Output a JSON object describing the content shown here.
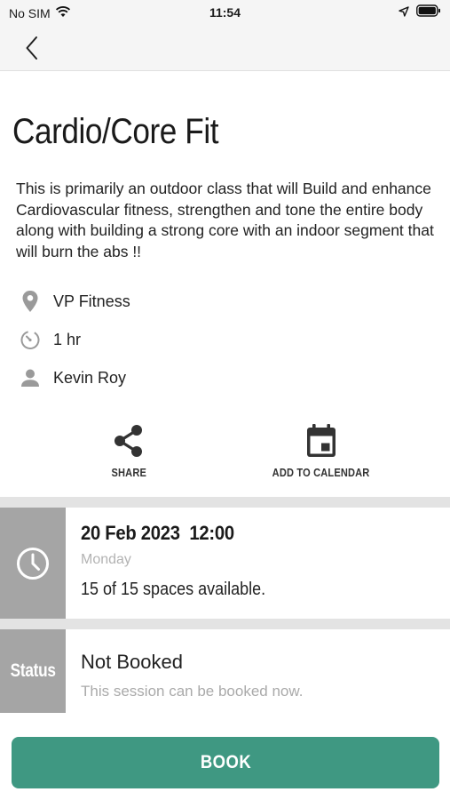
{
  "status_bar": {
    "carrier": "No SIM",
    "time": "11:54"
  },
  "class": {
    "title": "Cardio/Core Fit",
    "description": "This is primarily an outdoor class that will Build and enhance Cardiovascular fitness, strengthen and tone the entire body along with building a strong core with an indoor segment that will burn the abs !!",
    "location": "VP Fitness",
    "duration": "1 hr",
    "instructor": "Kevin Roy"
  },
  "actions": {
    "share_label": "SHARE",
    "calendar_label": "ADD TO CALENDAR"
  },
  "session": {
    "date_time": "20 Feb 2023  12:00",
    "day": "Monday",
    "spaces": "15 of 15 spaces available."
  },
  "status": {
    "label": "Status",
    "value": "Not Booked",
    "subtext": "This session can be booked now."
  },
  "book_label": "BOOK",
  "colors": {
    "accent": "#3f9882",
    "tile": "#a5a5a5",
    "separator": "#e3e3e3"
  }
}
